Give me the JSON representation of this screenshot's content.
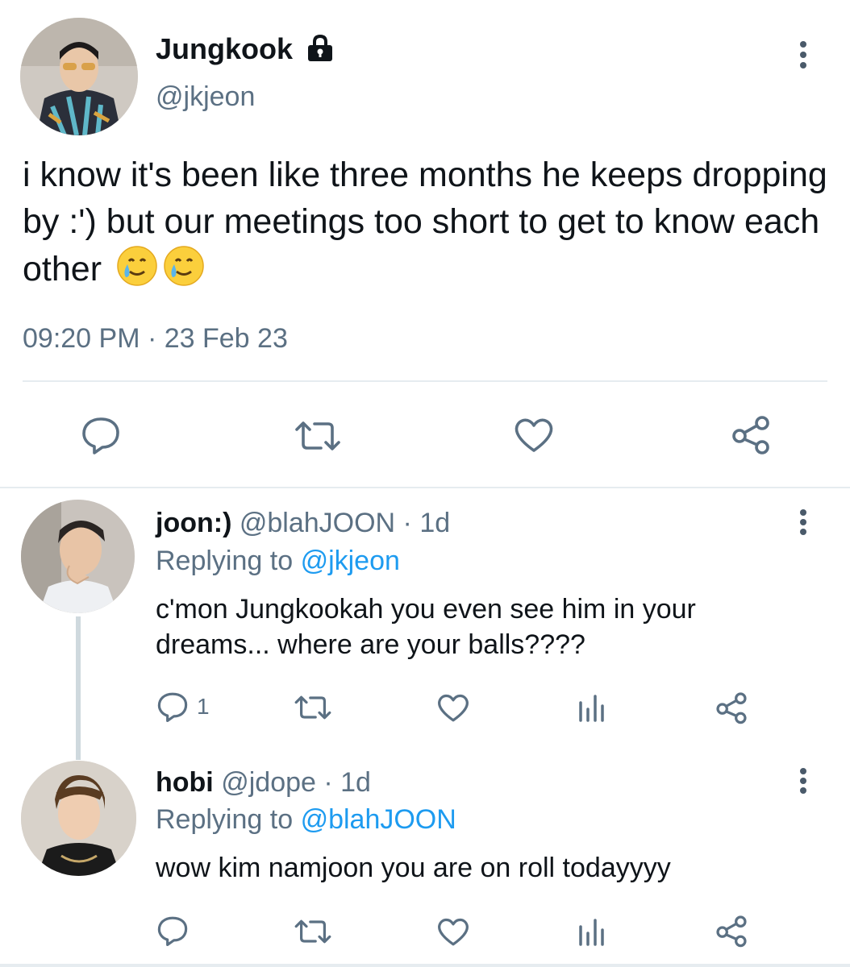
{
  "main_tweet": {
    "display_name": "Jungkook",
    "handle": "@jkjeon",
    "text": "i know it's been like three months he keeps dropping by :') but our meetings too short to get to know each other",
    "emoji_icons": [
      "smiling-face-with-tear-icon",
      "smiling-face-with-tear-icon"
    ],
    "timestamp": "09:20 PM · 23 Feb 23",
    "actions": [
      "reply-icon",
      "retweet-icon",
      "like-icon",
      "share-icon"
    ]
  },
  "replies": [
    {
      "display_name": "joon:)",
      "handle_time": "@blahJOON · 1d",
      "replying_prefix": "Replying to",
      "replying_to": "@jkjeon",
      "text": "c'mon Jungkookah you even see him in your dreams... where are your balls????",
      "reply_count": "1"
    },
    {
      "display_name": "hobi",
      "handle_time": "@jdope · 1d",
      "replying_prefix": "Replying to",
      "replying_to": "@blahJOON",
      "text": "wow kim namjoon you are on roll todayyyy",
      "reply_count": ""
    }
  ],
  "colors": {
    "text": "#0f1419",
    "secondary": "#5b7083",
    "link": "#1d9bf0",
    "divider": "#e6ecf0"
  }
}
